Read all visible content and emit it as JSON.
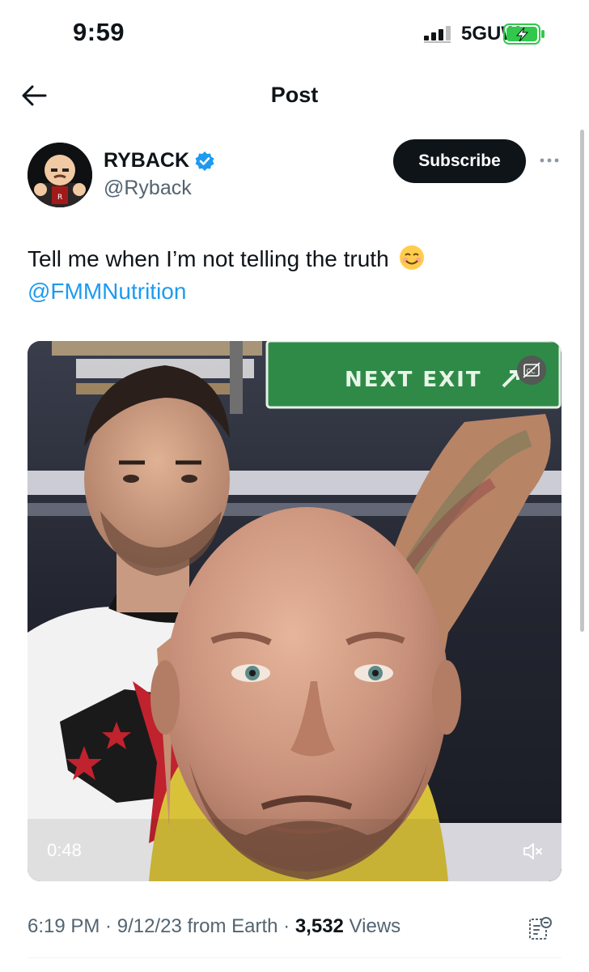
{
  "status_bar": {
    "time": "9:59",
    "network": "5GUW",
    "battery_icon": "battery-charging-icon",
    "accent": "#30c94b"
  },
  "nav": {
    "title": "Post",
    "back_icon": "back-arrow-icon"
  },
  "author": {
    "display_name": "RYBACK",
    "handle": "@Ryback",
    "verified_icon": "verified-badge-icon",
    "verified_color": "#1d9bf0",
    "subscribe_label": "Subscribe",
    "more_icon": "more-options-icon"
  },
  "tweet": {
    "text": "Tell me when I’m not telling the truth",
    "emoji": "smiling-face-icon",
    "mention": "@FMMNutrition"
  },
  "media": {
    "sign_text": "NEXT EXIT",
    "duration": "0:48",
    "captions_icon": "captions-icon",
    "mute_icon": "speaker-muted-icon"
  },
  "meta": {
    "time": "6:19 PM",
    "sep1": " · ",
    "date": "9/12/23",
    "source": " from Earth",
    "sep2": " · ",
    "views_count": "3,532",
    "views_label": " Views",
    "analytics_icon": "analytics-icon"
  },
  "colors": {
    "link": "#1d9bf0",
    "secondary_text": "#536471",
    "primary_text": "#0f1419"
  }
}
